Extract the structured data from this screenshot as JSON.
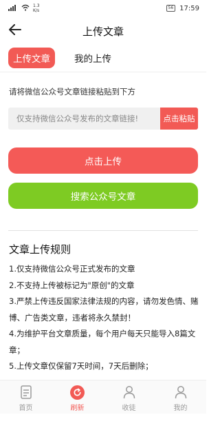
{
  "status_bar": {
    "net_speed_value": "1.3",
    "net_speed_unit": "K/s",
    "battery": "56",
    "time": "17:59"
  },
  "nav": {
    "title": "上传文章",
    "back_icon": "arrow-left-icon"
  },
  "tabs": [
    {
      "label": "上传文章",
      "active": true
    },
    {
      "label": "我的上传",
      "active": false
    }
  ],
  "form": {
    "instruction": "请将微信公众号文章链接粘贴到下方",
    "link_placeholder": "仅支持微信公众号发布的文章链接!",
    "paste_label": "点击粘贴"
  },
  "buttons": {
    "upload_label": "点击上传",
    "search_label": "搜索公众号文章"
  },
  "rules": {
    "title": "文章上传规则",
    "items": [
      "1.仅支持微信公众号正式发布的文章",
      "2.不支持上传被标记为\"原创\"的文章",
      "3.严禁上传违反国家法律法规的内容，请勿发色情、赌博、广告类文章，违者将永久禁封！",
      "4.为维护平台文章质量，每个用户每天只能导入8篇文章；",
      "5.上传文章仅保留7天时间，7天后删除；"
    ]
  },
  "tabbar": {
    "items": [
      {
        "label": "首页",
        "icon": "document-icon",
        "active": false
      },
      {
        "label": "刷新",
        "icon": "refresh-icon",
        "active": true
      },
      {
        "label": "收徒",
        "icon": "person-icon",
        "active": false
      },
      {
        "label": "我的",
        "icon": "person-icon",
        "active": false
      }
    ]
  },
  "colors": {
    "accent_red": "#f25a55",
    "accent_green": "#7ecb23"
  }
}
